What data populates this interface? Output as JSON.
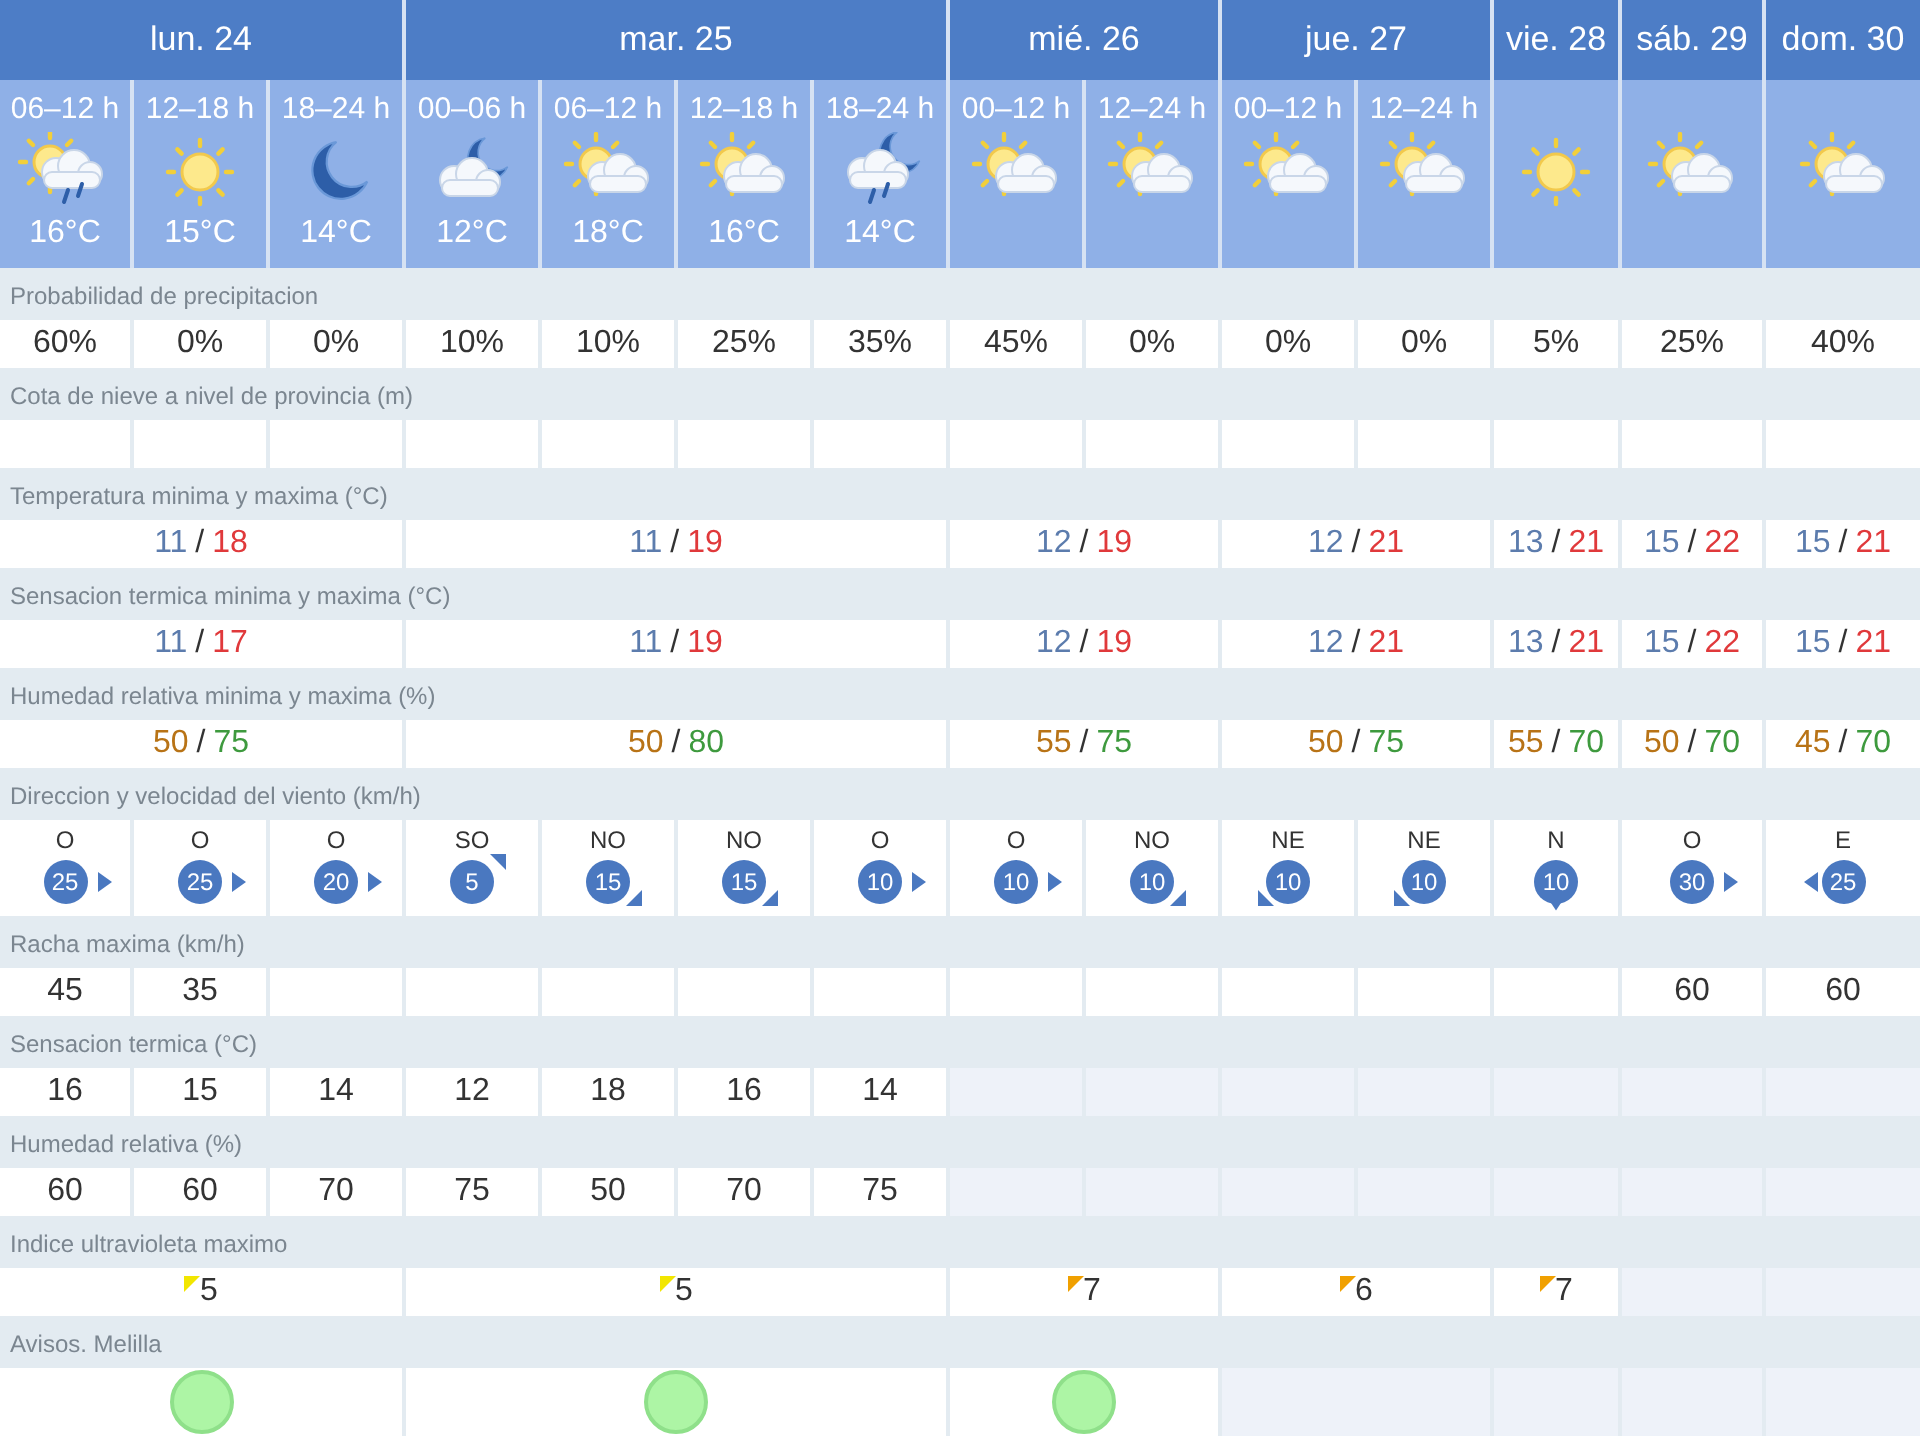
{
  "days": [
    {
      "label": "lun. 24",
      "periods": [
        {
          "time": "06–12 h",
          "kind": "sun-cloud-rain",
          "temp": "16°C"
        },
        {
          "time": "12–18 h",
          "kind": "sun",
          "temp": "15°C"
        },
        {
          "time": "18–24 h",
          "kind": "moon",
          "temp": "14°C"
        }
      ]
    },
    {
      "label": "mar. 25",
      "periods": [
        {
          "time": "00–06 h",
          "kind": "moon-cloud",
          "temp": "12°C"
        },
        {
          "time": "06–12 h",
          "kind": "sun-cloud",
          "temp": "18°C"
        },
        {
          "time": "12–18 h",
          "kind": "sun-cloud",
          "temp": "16°C"
        },
        {
          "time": "18–24 h",
          "kind": "moon-cloud-rain",
          "temp": "14°C"
        }
      ]
    },
    {
      "label": "mié. 26",
      "periods": [
        {
          "time": "00–12 h",
          "kind": "sun-cloud"
        },
        {
          "time": "12–24 h",
          "kind": "sun-cloud"
        }
      ]
    },
    {
      "label": "jue. 27",
      "periods": [
        {
          "time": "00–12 h",
          "kind": "sun-cloud"
        },
        {
          "time": "12–24 h",
          "kind": "sun-cloud"
        }
      ]
    },
    {
      "label": "vie. 28",
      "periods": [
        {
          "kind": "sun"
        }
      ]
    },
    {
      "label": "sáb. 29",
      "periods": [
        {
          "kind": "sun-cloud"
        }
      ]
    },
    {
      "label": "dom. 30",
      "periods": [
        {
          "kind": "sun-cloud"
        }
      ]
    }
  ],
  "rows": [
    {
      "label": "Probabilidad de precipitacion",
      "kind": "period",
      "cells": [
        {
          "value": "60%",
          "disabled": false
        },
        {
          "value": "0%",
          "disabled": false
        },
        {
          "value": "0%",
          "disabled": false
        },
        {
          "value": "10%",
          "disabled": false
        },
        {
          "value": "10%",
          "disabled": false
        },
        {
          "value": "25%",
          "disabled": false
        },
        {
          "value": "35%",
          "disabled": false
        },
        {
          "value": "45%",
          "disabled": false
        },
        {
          "value": "0%",
          "disabled": false
        },
        {
          "value": "0%",
          "disabled": false
        },
        {
          "value": "0%",
          "disabled": false
        },
        {
          "value": "5%",
          "disabled": false
        },
        {
          "value": "25%",
          "disabled": false
        },
        {
          "value": "40%",
          "disabled": false
        }
      ]
    },
    {
      "label": "Cota de nieve a nivel de provincia (m)",
      "kind": "period",
      "cells": [
        {
          "disabled": false
        },
        {
          "disabled": false
        },
        {
          "disabled": false
        },
        {
          "disabled": false
        },
        {
          "disabled": false
        },
        {
          "disabled": false
        },
        {
          "disabled": false
        },
        {
          "disabled": false
        },
        {
          "disabled": false
        },
        {
          "disabled": false
        },
        {
          "disabled": false
        },
        {
          "disabled": false
        },
        {
          "disabled": false
        },
        {
          "disabled": false
        }
      ]
    },
    {
      "label": "Temperatura minima y maxima (°C)",
      "kind": "temp_range",
      "cells": [
        {
          "min": "11",
          "separator": "/",
          "max": "18"
        },
        {
          "min": "11",
          "separator": "/",
          "max": "19"
        },
        {
          "min": "12",
          "separator": "/",
          "max": "19"
        },
        {
          "min": "12",
          "separator": "/",
          "max": "21"
        },
        {
          "min": "13",
          "separator": "/",
          "max": "21"
        },
        {
          "min": "15",
          "separator": "/",
          "max": "22"
        },
        {
          "min": "15",
          "separator": "/",
          "max": "21"
        }
      ]
    },
    {
      "label": "Sensacion termica minima y maxima (°C)",
      "kind": "temp_range",
      "cells": [
        {
          "min": "11",
          "separator": "/",
          "max": "17"
        },
        {
          "min": "11",
          "separator": "/",
          "max": "19"
        },
        {
          "min": "12",
          "separator": "/",
          "max": "19"
        },
        {
          "min": "12",
          "separator": "/",
          "max": "21"
        },
        {
          "min": "13",
          "separator": "/",
          "max": "21"
        },
        {
          "min": "15",
          "separator": "/",
          "max": "22"
        },
        {
          "min": "15",
          "separator": "/",
          "max": "21"
        }
      ]
    },
    {
      "label": "Humedad relativa minima y maxima (%)",
      "kind": "humidity_range",
      "cells": [
        {
          "min": "50",
          "separator": "/",
          "max": "75"
        },
        {
          "min": "50",
          "separator": "/",
          "max": "80"
        },
        {
          "min": "55",
          "separator": "/",
          "max": "75"
        },
        {
          "min": "50",
          "separator": "/",
          "max": "75"
        },
        {
          "min": "55",
          "separator": "/",
          "max": "70"
        },
        {
          "min": "50",
          "separator": "/",
          "max": "70"
        },
        {
          "min": "45",
          "separator": "/",
          "max": "70"
        }
      ]
    },
    {
      "label": "Direccion y velocidad del viento (km/h)",
      "kind": "wind",
      "cells": [
        {
          "direction": "O",
          "speed": "25",
          "kind": "right"
        },
        {
          "direction": "O",
          "speed": "25",
          "kind": "right"
        },
        {
          "direction": "O",
          "speed": "20",
          "kind": "right"
        },
        {
          "direction": "SO",
          "speed": "5",
          "kind": "top-right"
        },
        {
          "direction": "NO",
          "speed": "15",
          "kind": "bottom-right"
        },
        {
          "direction": "NO",
          "speed": "15",
          "kind": "bottom-right"
        },
        {
          "direction": "O",
          "speed": "10",
          "kind": "right"
        },
        {
          "direction": "O",
          "speed": "10",
          "kind": "right"
        },
        {
          "direction": "NO",
          "speed": "10",
          "kind": "bottom-right"
        },
        {
          "direction": "NE",
          "speed": "10",
          "kind": "bottom-left"
        },
        {
          "direction": "NE",
          "speed": "10",
          "kind": "bottom-left"
        },
        {
          "direction": "N",
          "speed": "10",
          "kind": "bottom"
        },
        {
          "direction": "O",
          "speed": "30",
          "kind": "right"
        },
        {
          "direction": "E",
          "speed": "25",
          "kind": "left"
        }
      ]
    },
    {
      "label": "Racha maxima (km/h)",
      "kind": "period",
      "cells": [
        {
          "value": "45",
          "disabled": false
        },
        {
          "value": "35",
          "disabled": false
        },
        {
          "disabled": false
        },
        {
          "disabled": false
        },
        {
          "disabled": false
        },
        {
          "disabled": false
        },
        {
          "disabled": false
        },
        {
          "disabled": false
        },
        {
          "disabled": false
        },
        {
          "disabled": false
        },
        {
          "disabled": false
        },
        {
          "disabled": false
        },
        {
          "value": "60",
          "disabled": false
        },
        {
          "value": "60",
          "disabled": false
        }
      ]
    },
    {
      "label": "Sensacion termica (°C)",
      "kind": "period",
      "cells": [
        {
          "value": "16",
          "disabled": false
        },
        {
          "value": "15",
          "disabled": false
        },
        {
          "value": "14",
          "disabled": false
        },
        {
          "value": "12",
          "disabled": false
        },
        {
          "value": "18",
          "disabled": false
        },
        {
          "value": "16",
          "disabled": false
        },
        {
          "value": "14",
          "disabled": false
        },
        {
          "disabled": true
        },
        {
          "disabled": true
        },
        {
          "disabled": true
        },
        {
          "disabled": true
        },
        {
          "disabled": true
        },
        {
          "disabled": true
        },
        {
          "disabled": true
        }
      ]
    },
    {
      "label": "Humedad relativa (%)",
      "kind": "period",
      "cells": [
        {
          "value": "60",
          "disabled": false
        },
        {
          "value": "60",
          "disabled": false
        },
        {
          "value": "70",
          "disabled": false
        },
        {
          "value": "75",
          "disabled": false
        },
        {
          "value": "50",
          "disabled": false
        },
        {
          "value": "70",
          "disabled": false
        },
        {
          "value": "75",
          "disabled": false
        },
        {
          "disabled": true
        },
        {
          "disabled": true
        },
        {
          "disabled": true
        },
        {
          "disabled": true
        },
        {
          "disabled": true
        },
        {
          "disabled": true
        },
        {
          "disabled": true
        }
      ]
    },
    {
      "label": "Indice ultravioleta maximo",
      "kind": "uv",
      "cells": [
        {
          "value": "5",
          "color": "#f2e600",
          "disabled": false
        },
        {
          "value": "5",
          "color": "#f2e600",
          "disabled": false
        },
        {
          "value": "7",
          "color": "#f0a000",
          "disabled": false
        },
        {
          "value": "6",
          "color": "#f0a000",
          "disabled": false
        },
        {
          "value": "7",
          "color": "#f0a000",
          "disabled": false
        },
        {
          "disabled": true
        },
        {
          "disabled": true
        }
      ]
    },
    {
      "label": "Avisos. Melilla",
      "kind": "warning",
      "cells": [
        {
          "color": "#adf5a5",
          "disabled": false
        },
        {
          "color": "#adf5a5",
          "disabled": false
        },
        {
          "color": "#adf5a5",
          "disabled": false
        },
        {
          "disabled": true
        },
        {
          "disabled": true
        },
        {
          "disabled": true
        },
        {
          "disabled": true
        }
      ]
    }
  ]
}
